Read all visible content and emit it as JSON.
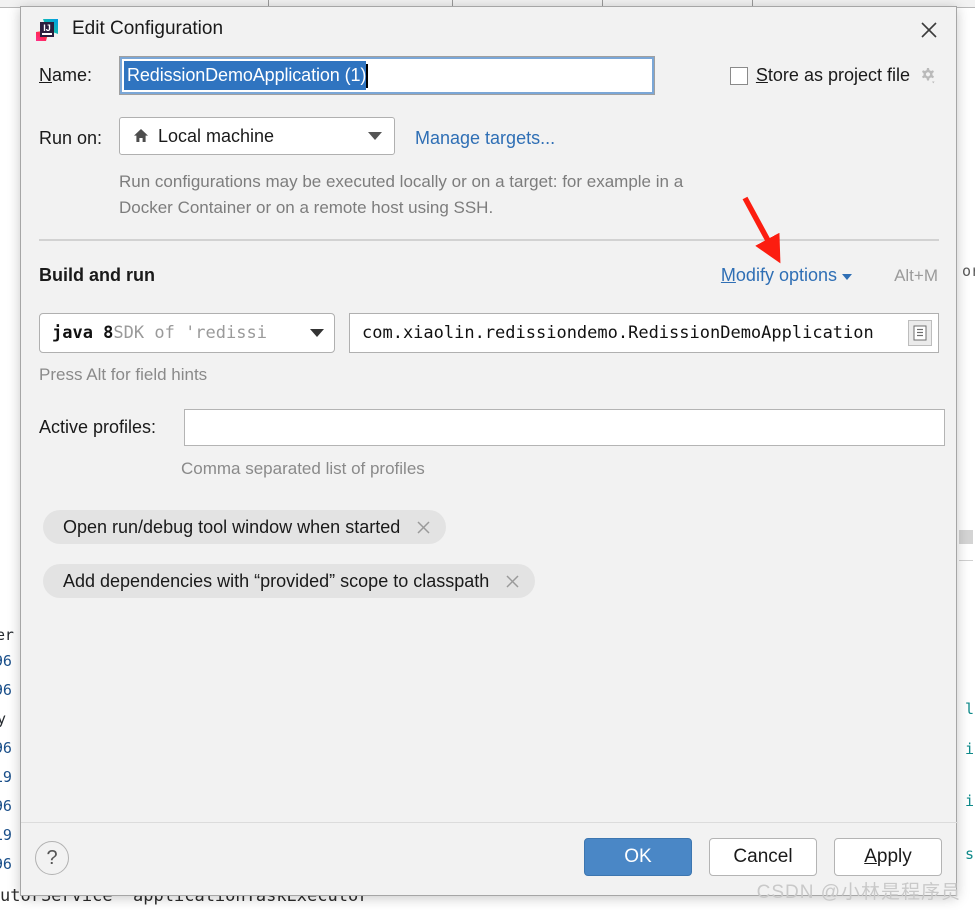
{
  "window": {
    "title": "Edit Configuration",
    "logo_icon": "intellij-idea-logo",
    "close_icon": "close-icon"
  },
  "name_row": {
    "label": "Name:",
    "label_mnemonic": "N",
    "label_rest": "ame:",
    "value": "RedissionDemoApplication (1)",
    "selected": true
  },
  "store_as_project_file": {
    "label_mnemonic": "S",
    "label_rest": "tore as project file",
    "full_label": "Store as project file",
    "checked": false,
    "gear_icon": "gear-icon"
  },
  "run_on": {
    "label": "Run on:",
    "selected_value": "Local machine",
    "target_icon": "home-icon",
    "manage_targets_link": "Manage targets...",
    "description": "Run configurations may be executed locally or on a target: for example in a Docker Container or on a remote host using SSH."
  },
  "build_and_run": {
    "section_title": "Build and run",
    "modify_options_label": "Modify options",
    "modify_options_mnemonic": "M",
    "modify_options_rest": "odify options",
    "modify_options_shortcut": "Alt+M",
    "sdk": {
      "primary": "java 8",
      "secondary": "SDK of 'redissi",
      "full_text": "java 8 SDK of 'redissi"
    },
    "main_class": "com.xiaolin.redissiondemo.RedissionDemoApplication",
    "main_class_browse_icon": "document-list-icon",
    "field_hint": "Press Alt for field hints"
  },
  "active_profiles": {
    "label": "Active profiles:",
    "value": "",
    "placeholder": "",
    "description": "Comma separated list of profiles"
  },
  "option_chips": [
    {
      "label": "Open run/debug tool window when started",
      "remove_icon": "close-icon"
    },
    {
      "label": "Add dependencies with “provided” scope to classpath",
      "remove_icon": "close-icon"
    }
  ],
  "footer": {
    "help_label": "?",
    "ok_label": "OK",
    "cancel_label": "Cancel",
    "apply_mnemonic": "A",
    "apply_rest": "pply",
    "apply_label": "Apply"
  },
  "annotation": {
    "arrow_color": "#fc1d10",
    "points_to": "Modify options"
  },
  "watermark": {
    "text": "CSDN @小林是程序员"
  },
  "background": {
    "left_fragments": [
      "er",
      "96",
      "96",
      "y",
      "96",
      "19",
      "96",
      "19",
      "96",
      "utor"
    ],
    "bottom_text": "utorService 'applicationTaskExecutor'",
    "right_fragments": [
      "or",
      "l",
      "i",
      "i",
      "s"
    ]
  },
  "colors": {
    "dialog_bg": "#f2f2f2",
    "accent_blue": "#2f6fb5",
    "ok_button": "#4a87c6",
    "selection_blue": "#2f74c0",
    "chip_bg": "#e3e3e3",
    "muted_text": "#8a8a8a",
    "arrow_red": "#fc1d10"
  }
}
